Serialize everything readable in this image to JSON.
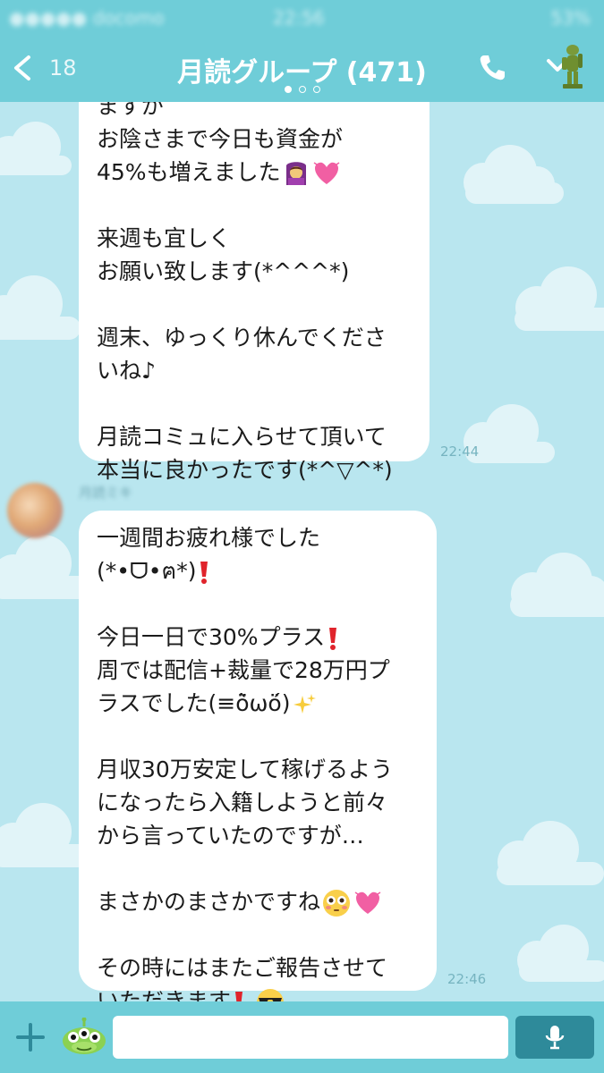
{
  "colors": {
    "header": "#6fcdd8",
    "background": "#b9e6ef",
    "time": "#76b4c0",
    "send": "#2e8a9a"
  },
  "status_bar": {
    "carrier": "●●●●● docomo",
    "time": "22:56",
    "battery": "53%"
  },
  "header": {
    "back_icon": "chevron-left-icon",
    "unread_count": "18",
    "title": "月読グループ (471)",
    "page_dots": 3,
    "active_dot": 0
  },
  "messages": [
    {
      "lines": [
        "ますが",
        "お陰さまで今日も資金が",
        "45%も増えました",
        "",
        "来週も宜しく",
        "お願い致します(*^^^*)",
        "",
        "週末、ゆっくり休んでくださ",
        "いね♪",
        "",
        "月読コミュに入らせて頂いて",
        "本当に良かったです(*^▽^*)"
      ],
      "emojis": [
        "person-gesturing-ok-emoji",
        "pink-heart-emoji"
      ],
      "time": "22:44"
    },
    {
      "sender": "月読ミキ",
      "lines": [
        "一週間お疲れ様でした",
        "(*•ᗜ•ฅ*)",
        "",
        "今日一日で30%プラス",
        "周では配信+裁量で28万円プ",
        "ラスでした(≡ö̀ωö́)",
        "",
        "月収30万安定して稼げるよう",
        "になったら入籍しようと前々",
        "から言っていたのですが…",
        "",
        "まさかのまさかですね",
        "",
        "その時にはまたご報告させて",
        "いただきます"
      ],
      "emojis": [
        "red-exclamation-emoji",
        "sparkles-emoji",
        "flushed-face-emoji",
        "pink-heart-emoji",
        "sunglasses-emoji"
      ],
      "time": "22:46"
    }
  ],
  "footer": {
    "input_placeholder": "",
    "input_value": ""
  }
}
